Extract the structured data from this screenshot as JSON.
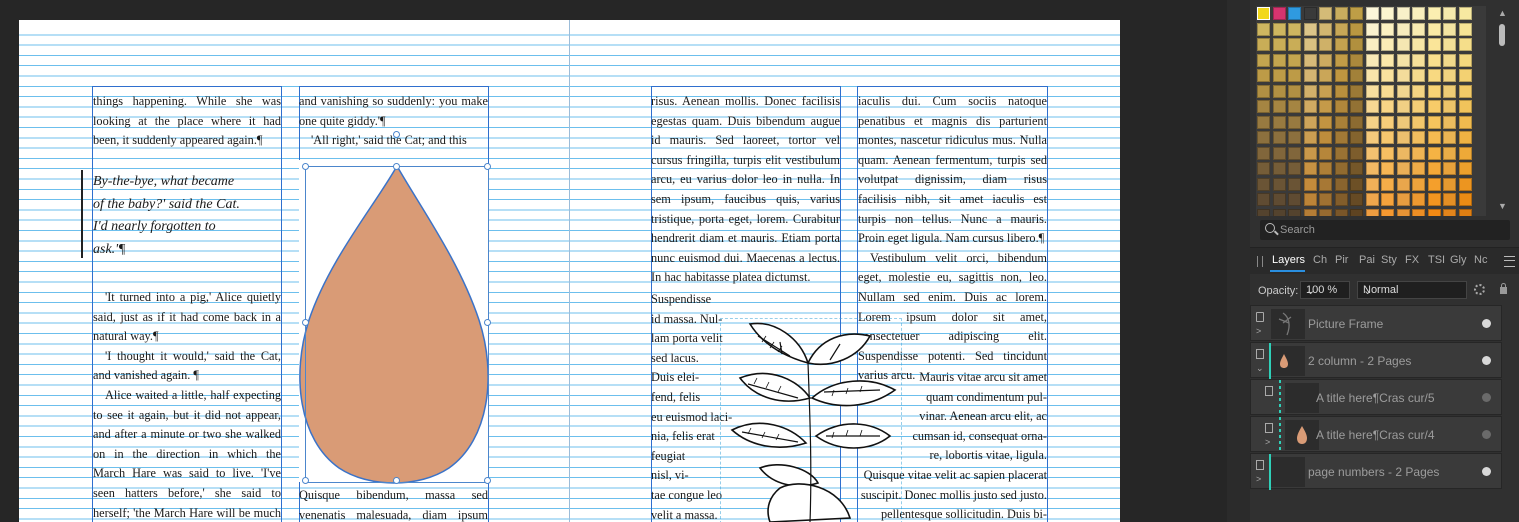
{
  "document": {
    "left_page": {
      "col1_top": "things happening. While she was looking at the place where it had been, it suddenly appeared again.¶",
      "pull_quote": [
        "By-the-bye, what became",
        "of the baby?' said the Cat.",
        "I'd nearly forgotten to",
        "ask.'¶"
      ],
      "col1_p1": "'It turned into a pig,' Alice quietly said, just as if it had come back in a natural way.¶",
      "col1_p2": "'I thought it would,' said the Cat, and vanished again. ¶",
      "col1_p3": "Alice waited a little, half expecting to see it again, but it did not appear, and after a minute or two she walked on in the direction in which the March Hare was said to live. 'I've seen hatters before,' she said to herself; 'the March Hare will be much the",
      "col2_top": "and vanishing so suddenly: you make one quite giddy.'¶",
      "col2_p2": "'All right,' said the Cat; and this",
      "col2_bottom": "Quisque bibendum, massa sed venenatis malesuada, diam ipsum blandit"
    },
    "right_page": {
      "col1_text": "risus. Aenean mollis. Donec facilisis egestas quam. Duis bibendum augue id mauris. Sed laoreet, tortor vel cursus fringilla, turpis elit vestibulum arcu, eu varius dolor leo in nulla. In sem ipsum, faucibus quis, varius tristique, porta eget, lorem. Curabitur hendrerit diam et mauris. Etiam porta nunc euismod dui. Maecenas a lectus. In hac habitasse platea dictumst.",
      "col1_wrap": [
        "Suspendisse",
        "id massa. Nul-",
        "lam porta velit",
        "sed lacus.",
        "Duis elei-",
        "fend, felis",
        "eu euismod laci-",
        "nia, felis erat",
        "feugiat",
        "nisl, vi-",
        "tae congue leo",
        "velit a massa."
      ],
      "col2_text": "iaculis dui. Cum sociis natoque penatibus et magnis dis parturient montes, nascetur ridiculus mus. Nulla quam. Aenean fermentum, turpis sed volutpat dignissim, diam risus facilisis nibh, sit amet iaculis est turpis non tellus. Nunc a mauris. Proin eget ligula. Nam cursus libero.¶",
      "col2_p2": "Vestibulum velit orci, bibendum eget, molestie eu, sagittis non, leo. Nullam sed enim. Duis ac lorem. Lorem ipsum dolor sit amet, consectetuer adipiscing elit. Suspendisse potenti. Sed tincidunt varius arcu.",
      "col2_wrap": [
        "Mauris vitae arcu sit amet",
        "quam condimentum pul-",
        "vinar. Aenean arcu elit, ac",
        "cumsan id, consequat orna-",
        "re, lobortis vitae, ligula.",
        "Quisque vitae velit ac sapien placerat",
        "suscipit. Donec mollis justo sed justo.",
        "pellentesque sollicitudin. Duis bi-"
      ]
    }
  },
  "panel": {
    "search_placeholder": "Search",
    "tabs": [
      "Layers",
      "Ch",
      "Pir",
      "Pai",
      "Sty",
      "FX",
      "TSI",
      "Gly",
      "Nc"
    ],
    "opacity_label": "Opacity:",
    "opacity_value": "100 %",
    "blend_mode": "Normal",
    "layers": [
      {
        "name": "Picture Frame"
      },
      {
        "name": "2 column - 2 Pages"
      },
      {
        "name": "A title here¶Cras cur/5"
      },
      {
        "name": "A title here¶Cras cur/4"
      },
      {
        "name": "page numbers - 2 Pages"
      }
    ]
  },
  "colors": {
    "accent": "#2a8fe0",
    "teardrop_fill": "#d99b76",
    "guide": "#52b4ea",
    "frame": "#2f6fce",
    "teal": "#2fd0b8"
  }
}
